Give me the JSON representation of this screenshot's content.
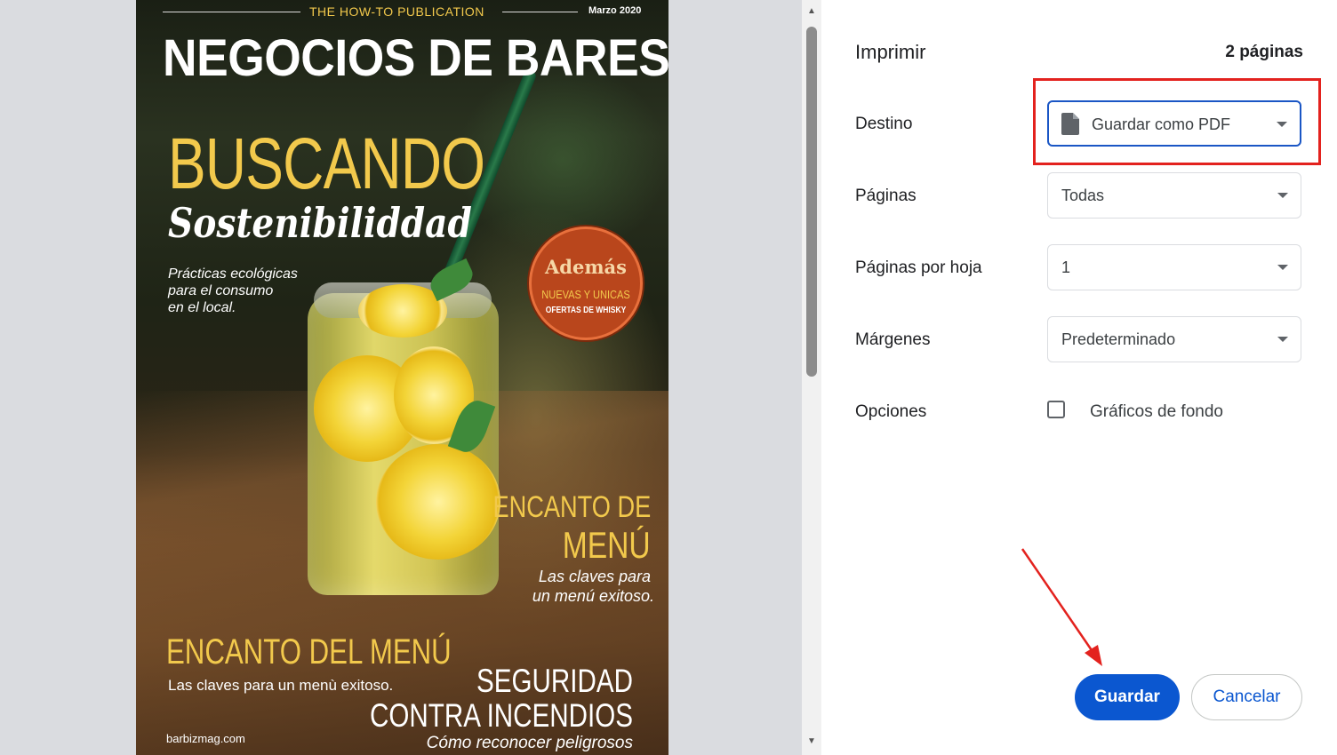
{
  "preview": {
    "cover": {
      "tagline": "THE HOW-TO PUBLICATION",
      "date": "Marzo 2020",
      "title": "NEGOCIOS DE BARES",
      "headline": "BUSCANDO",
      "subheadline": "Sostenibiliddad",
      "blurb": [
        "Prácticas ecológicas",
        "para el consumo",
        "en el local."
      ],
      "badge": {
        "title": "Además",
        "line1": "NUEVAS Y UNICAS",
        "line2": "OFERTAS DE WHISKY"
      },
      "story1": {
        "title1": "ENCANTO DE",
        "title2": "MENÚ",
        "sub1": "Las claves para",
        "sub2": "un menú exitoso."
      },
      "story2": {
        "title": "ENCANTO DEL MENÚ",
        "sub": "Las claves para un menù exitoso."
      },
      "story3": {
        "title1": "SEGURIDAD",
        "title2": "CONTRA INCENDIOS",
        "sub": "Cómo reconocer peligrosos"
      },
      "website": "barbizmag.com"
    }
  },
  "scrollbar": {
    "up_arrow": "▲",
    "down_arrow": "▼"
  },
  "settings": {
    "title": "Imprimir",
    "page_count": "2 páginas",
    "destination": {
      "label": "Destino",
      "value": "Guardar como PDF",
      "icon": "pdf-document-icon"
    },
    "pages": {
      "label": "Páginas",
      "value": "Todas"
    },
    "pages_per_sheet": {
      "label": "Páginas por hoja",
      "value": "1"
    },
    "margins": {
      "label": "Márgenes",
      "value": "Predeterminado"
    },
    "options": {
      "label": "Opciones",
      "checkbox_label": "Gráficos de fondo",
      "checked": false
    },
    "save_label": "Guardar",
    "cancel_label": "Cancelar"
  },
  "annotations": {
    "highlight_color": "#e3221e",
    "arrow_color": "#e3221e"
  },
  "colors": {
    "accent": "#0b57d0",
    "cover_yellow": "#f2c94c",
    "badge_orange": "#b9461c"
  }
}
